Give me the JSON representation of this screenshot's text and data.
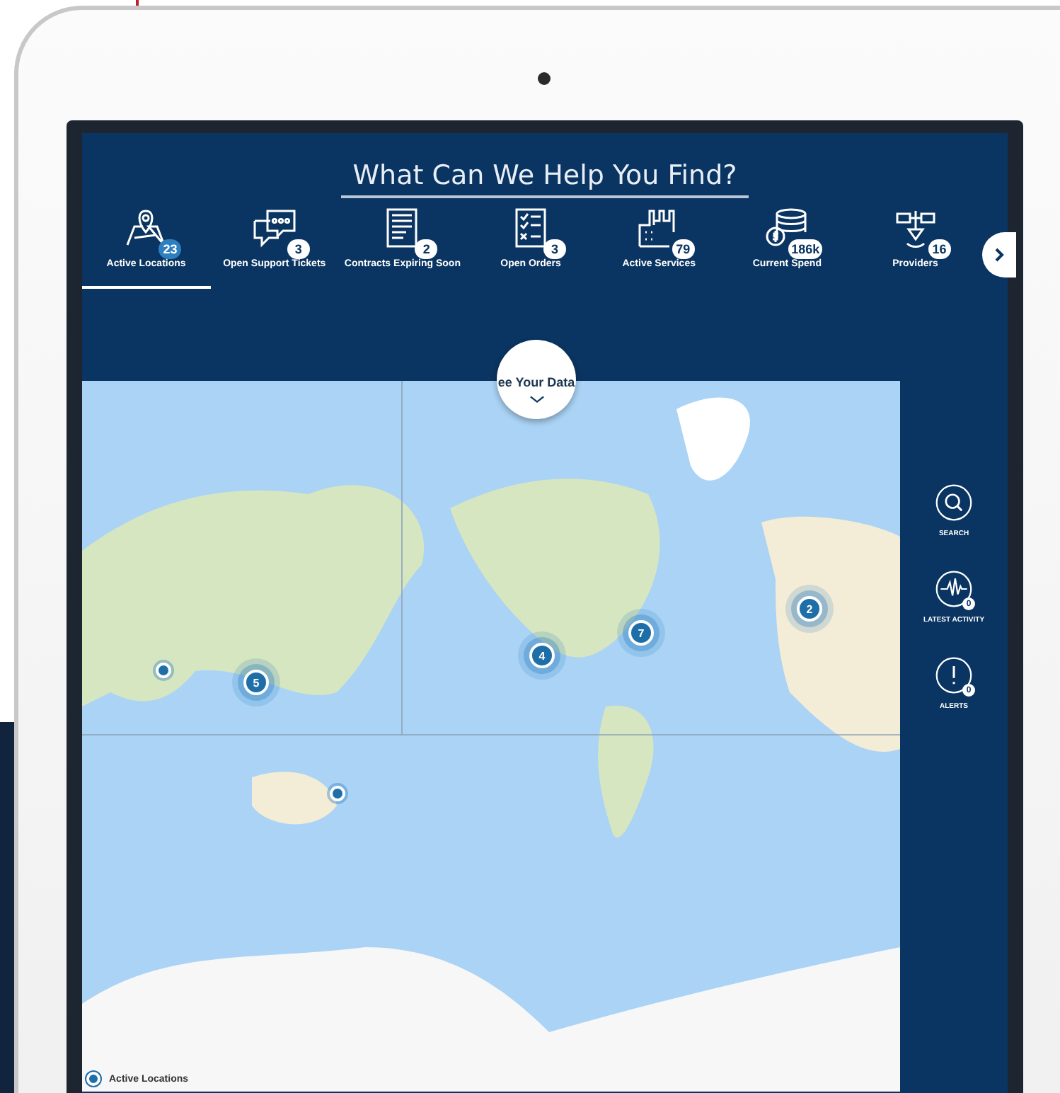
{
  "header": {
    "title": "What Can We Help You Find?"
  },
  "tiles": [
    {
      "kind": "map",
      "label": "Active Locations",
      "count": "23",
      "selected": true
    },
    {
      "kind": "chat",
      "label": "Open Support Tickets",
      "count": "3",
      "selected": false
    },
    {
      "kind": "document",
      "label": "Contracts Expiring Soon",
      "count": "2",
      "selected": false
    },
    {
      "kind": "checklist",
      "label": "Open Orders",
      "count": "3",
      "selected": false
    },
    {
      "kind": "factory",
      "label": "Active Services",
      "count": "79",
      "selected": false
    },
    {
      "kind": "coins",
      "label": "Current Spend",
      "count": "186k",
      "selected": false
    },
    {
      "kind": "satellite",
      "label": "Providers",
      "count": "16",
      "selected": false
    }
  ],
  "see_data": {
    "label": "ee Your Data"
  },
  "map": {
    "clusters": [
      {
        "count": "5"
      },
      {
        "count": "4"
      },
      {
        "count": "7"
      },
      {
        "count": "2"
      }
    ]
  },
  "sidebar": {
    "items": [
      {
        "kind": "search",
        "label": "SEARCH"
      },
      {
        "kind": "activity",
        "label": "LATEST ACTIVITY",
        "badge": "0"
      },
      {
        "kind": "alert",
        "label": "ALERTS",
        "badge": "0"
      }
    ]
  },
  "legend": {
    "label": "Active Locations"
  }
}
